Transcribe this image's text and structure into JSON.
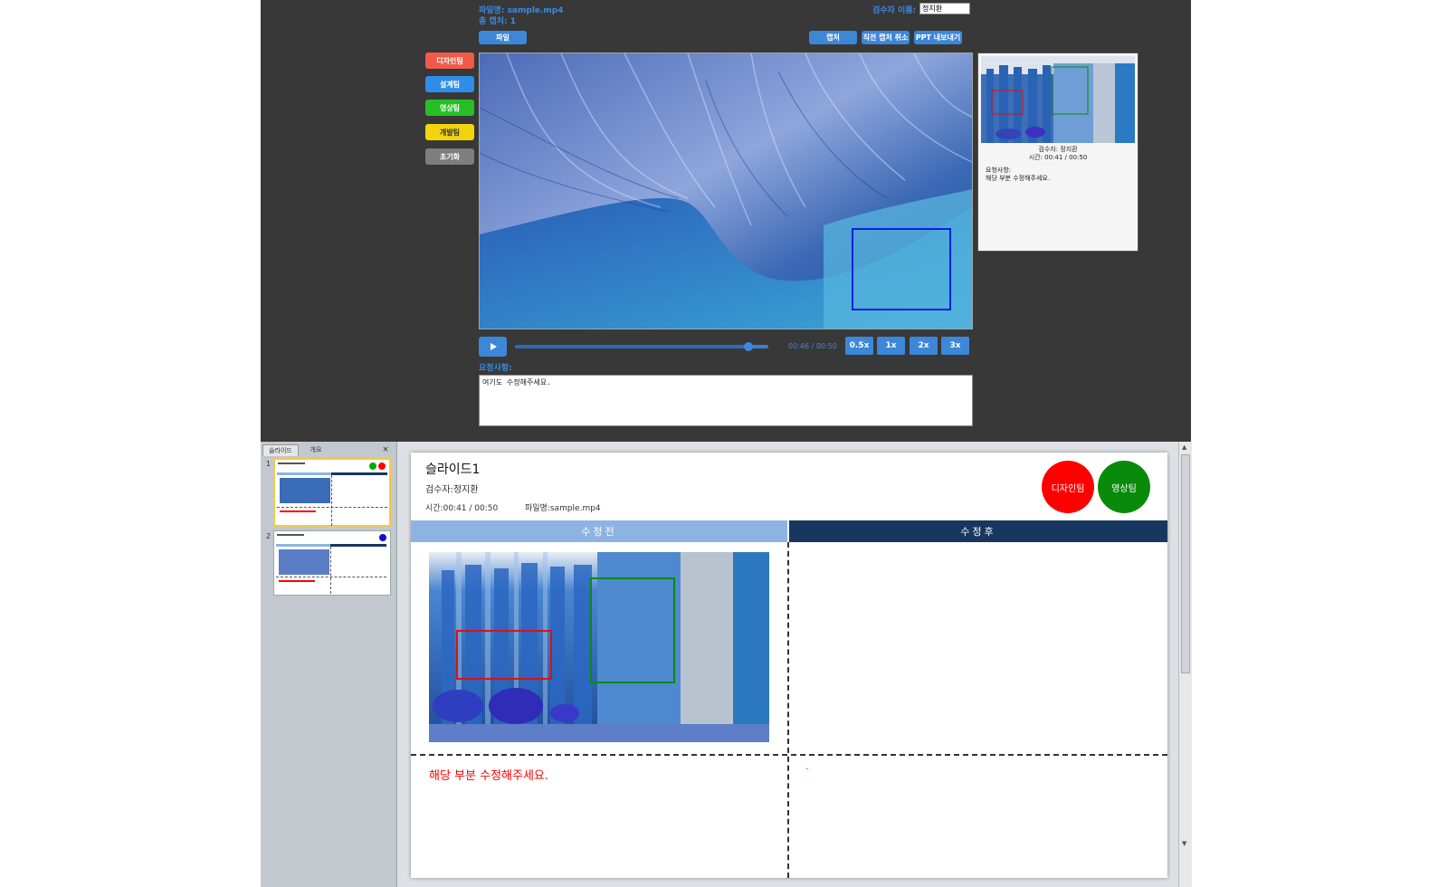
{
  "top": {
    "filename_line": "파일명: sample.mp4",
    "total_captures_line": "총 캡처: 1",
    "reviewer_label": "검수자 이름:",
    "reviewer_value": "정지환",
    "open_button": "파일",
    "capture_button": "캡처",
    "undo_button": "직전 캡처 취소",
    "export_button": "PPT 내보내기",
    "team_buttons": [
      {
        "label": "디자인팀",
        "color": "#f05a4a"
      },
      {
        "label": "설계팀",
        "color": "#2f8de8"
      },
      {
        "label": "영상팀",
        "color": "#26c026"
      },
      {
        "label": "개발팀",
        "color": "#f2d40c"
      },
      {
        "label": "초기화",
        "color": "#7e7e7e"
      }
    ],
    "thumb_card": {
      "reviewer": "검수자: 정지환",
      "time": "시간: 00:41 / 00:50",
      "request_label": "요청사항:",
      "request_text": "해당 부분 수정해주세요."
    },
    "playback": {
      "play_icon": "play-icon",
      "progress": 0.92,
      "time_text": "00:46 / 00:50",
      "speeds": [
        "0.5x",
        "1x",
        "2x",
        "3x"
      ]
    },
    "request_label": "요청사항:",
    "request_text": "여기도 수정해주세요."
  },
  "bottom": {
    "panel_tabs": [
      "슬라이드",
      "개요"
    ],
    "panel_close": "×",
    "thumb_numbers": [
      "1",
      "2"
    ],
    "slide": {
      "title": "슬라이드1",
      "reviewer": "검수자:정지환",
      "time": "시간:00:41 / 00:50",
      "filename": "파일명:sample.mp4",
      "badges": [
        {
          "label": "디자인팀",
          "color": "#ff0000"
        },
        {
          "label": "영상팀",
          "color": "#0a8a0a"
        }
      ],
      "before_header": "수정전",
      "after_header": "수정후",
      "before_header_color": "#8db3e2",
      "after_header_color": "#17375e",
      "before_comment": "해당 부분 수정해주세요.",
      "after_comment": "."
    }
  }
}
